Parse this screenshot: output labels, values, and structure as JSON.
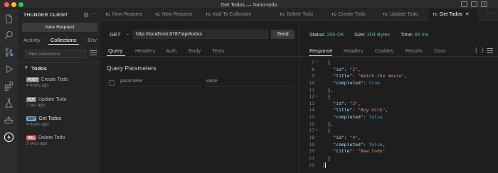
{
  "window": {
    "title": "Get Todos — hono-todo"
  },
  "activity_bar": {
    "icons": [
      "files-icon",
      "search-icon",
      "source-control-icon",
      "run-debug-icon",
      "extensions-icon",
      "testing-icon",
      "docker-icon",
      "thunder-client-icon"
    ]
  },
  "sidebar": {
    "title": "THUNDER CLIENT",
    "new_request_label": "New Request",
    "tabs": [
      "Activity",
      "Collections",
      "Env"
    ],
    "active_tab": "Collections",
    "filter_placeholder": "filter collections",
    "collection": {
      "name": "Todos",
      "requests": [
        {
          "method": "POST",
          "name": "Create Todo",
          "time": "4 hours ago"
        },
        {
          "method": "PUT",
          "name": "Update Todo",
          "time": "1 sec ago"
        },
        {
          "method": "GET",
          "name": "Get Todos",
          "time": "4 hours ago"
        },
        {
          "method": "DEL",
          "name": "Delete Todo",
          "time": "2 secs ago"
        }
      ]
    }
  },
  "editor_tabs": [
    {
      "badge": "TC",
      "label": "New Request"
    },
    {
      "badge": "TC",
      "label": "New Request"
    },
    {
      "badge": "TC",
      "label": "Add To Collection"
    },
    {
      "badge": "TC",
      "label": "Delete Todo"
    },
    {
      "badge": "TC",
      "label": "Create Todo"
    },
    {
      "badge": "TC",
      "label": "Update Todo"
    },
    {
      "badge": "TC",
      "label": "Get Todos",
      "active": true
    }
  ],
  "request": {
    "method": "GET",
    "url": "http://localhost:8787/api/todos",
    "send_label": "Send",
    "tabs": [
      "Query",
      "Headers",
      "Auth",
      "Body",
      "Tests"
    ],
    "active_tab": "Query",
    "query_title": "Query Parameters",
    "param_placeholder": "parameter",
    "value_placeholder": "value"
  },
  "response": {
    "status_label": "Status:",
    "status_value": "200 OK",
    "size_label": "Size:",
    "size_value": "204 Bytes",
    "time_label": "Time:",
    "time_value": "65 ms",
    "tabs": [
      "Response",
      "Headers",
      "Cookies",
      "Results",
      "Docs"
    ],
    "active_tab": "Response",
    "braces_label": "{ }",
    "lines": [
      {
        "n": "7",
        "fold": true,
        "text": "{"
      },
      {
        "n": "8",
        "key": "\"id\"",
        "val": "\"2\"",
        "kind": "str",
        "comma": true
      },
      {
        "n": "9",
        "key": "\"title\"",
        "val": "\"Watch the movie\"",
        "kind": "str",
        "comma": true
      },
      {
        "n": "10",
        "key": "\"completed\"",
        "val": "true",
        "kind": "kw",
        "comma": false
      },
      {
        "n": "11",
        "text": "},"
      },
      {
        "n": "12",
        "fold": true,
        "text": "{"
      },
      {
        "n": "13",
        "key": "\"id\"",
        "val": "\"3\"",
        "kind": "str",
        "comma": true
      },
      {
        "n": "14",
        "key": "\"title\"",
        "val": "\"Buy milk\"",
        "kind": "str",
        "comma": true
      },
      {
        "n": "15",
        "key": "\"completed\"",
        "val": "false",
        "kind": "kw",
        "comma": false
      },
      {
        "n": "16",
        "text": "},"
      },
      {
        "n": "17",
        "fold": true,
        "text": "{"
      },
      {
        "n": "18",
        "key": "\"id\"",
        "val": "\"4\"",
        "kind": "str",
        "comma": true
      },
      {
        "n": "19",
        "key": "\"completed\"",
        "val": "false",
        "kind": "kw",
        "comma": true
      },
      {
        "n": "20",
        "key": "\"title\"",
        "val": "\"New todo\"",
        "kind": "str",
        "comma": false
      },
      {
        "n": "21",
        "text": "}"
      },
      {
        "n": "22",
        "text": "]",
        "cursor": true
      }
    ]
  }
}
